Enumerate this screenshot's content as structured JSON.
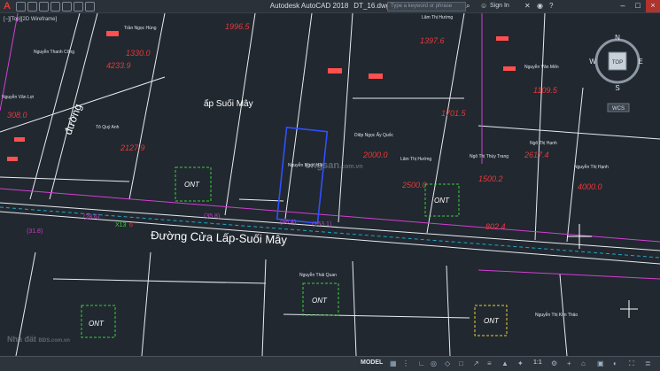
{
  "app": {
    "logo": "A",
    "title": "Autodesk AutoCAD 2018",
    "filename": "DT_16.dwg",
    "search_placeholder": "Type a keyword or phrase",
    "signin": "Sign In"
  },
  "viewport": {
    "label": "[−][Top][2D Wireframe]"
  },
  "viewcube": {
    "n": "N",
    "s": "S",
    "e": "E",
    "w": "W",
    "top": "TOP",
    "wcs": "WCS"
  },
  "drawing": {
    "road_label": "Đường Cửa Lấp-Suối Mây",
    "hamlet_label": "ấp Suối Mây",
    "vertical_road_label": "đường",
    "ont_labels": [
      "ONT",
      "ONT",
      "ONT",
      "ONT",
      "ONT",
      "ONT"
    ],
    "owners": [
      "Trần Ngọc Hùng",
      "Nguyễn Thanh Công",
      "Nguyễn Văn Lợi",
      "Tô Quý Anh",
      "Nguyễn Ngọc Hải",
      "Diệp Ngọc Ấy Quốc",
      "Lâm Thị Hường",
      "Lâm Thị Hường",
      "Ngô Thị Thùy Trang",
      "Ngô Thị Hạnh",
      "Nguyễn Văn Mến",
      "Nguyễn Thị Hạnh",
      "Nguyễn Thái Quan",
      "Nguyễn Thị Kim Thảo"
    ],
    "parcel_areas": [
      "1330.0",
      "1996.5",
      "308.0",
      "2127.9",
      "4233.9",
      "1397.6",
      "1701.5",
      "2000.0",
      "2500.0",
      "1500.2",
      "2617.4",
      "4000.0",
      "1109.5",
      "802.4"
    ],
    "edge_dims": [
      "(96.4)",
      "(35.8)",
      "(28.6)",
      "(153.1)",
      "(31.8)"
    ],
    "coord_mark": "X13",
    "coord_value": "6"
  },
  "status": {
    "model": "MODEL",
    "scale": "1:1"
  },
  "watermark": {
    "brand_top": "BĐS.com.vn",
    "brand": "Nhà đất",
    "site": "ongsan",
    "site_top": ".com.vn"
  }
}
